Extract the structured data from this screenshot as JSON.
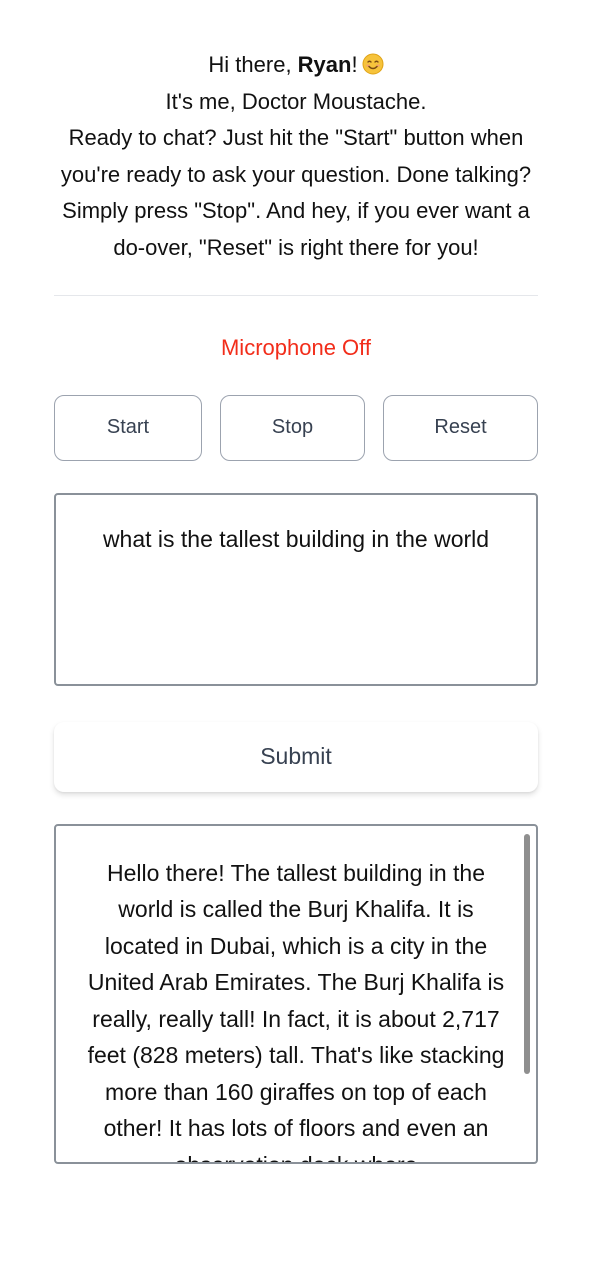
{
  "greeting": {
    "prefix": "Hi there, ",
    "user_name": "Ryan",
    "suffix": "!",
    "emoji_icon": "smiling-face-emoji",
    "line2": "It's me, Doctor Moustache.",
    "line3": "Ready to chat? Just hit the \"Start\" button when you're ready to ask your question. Done talking? Simply press \"Stop\". And hey, if you ever want a do-over, \"Reset\" is right there for you!"
  },
  "mic": {
    "status_text": "Microphone Off",
    "status_color": "#f22d1a"
  },
  "controls": {
    "start_label": "Start",
    "stop_label": "Stop",
    "reset_label": "Reset"
  },
  "question": {
    "value": "what is the tallest building in the world"
  },
  "submit": {
    "label": "Submit"
  },
  "answer": {
    "text": "Hello there! The tallest building in the world is called the Burj Khalifa. It is located in Dubai, which is a city in the United Arab Emirates. The Burj Khalifa is really, really tall! In fact, it is about 2,717 feet (828 meters) tall. That's like stacking more than 160 giraffes on top of each other! It has lots of floors and even an observation deck where"
  }
}
